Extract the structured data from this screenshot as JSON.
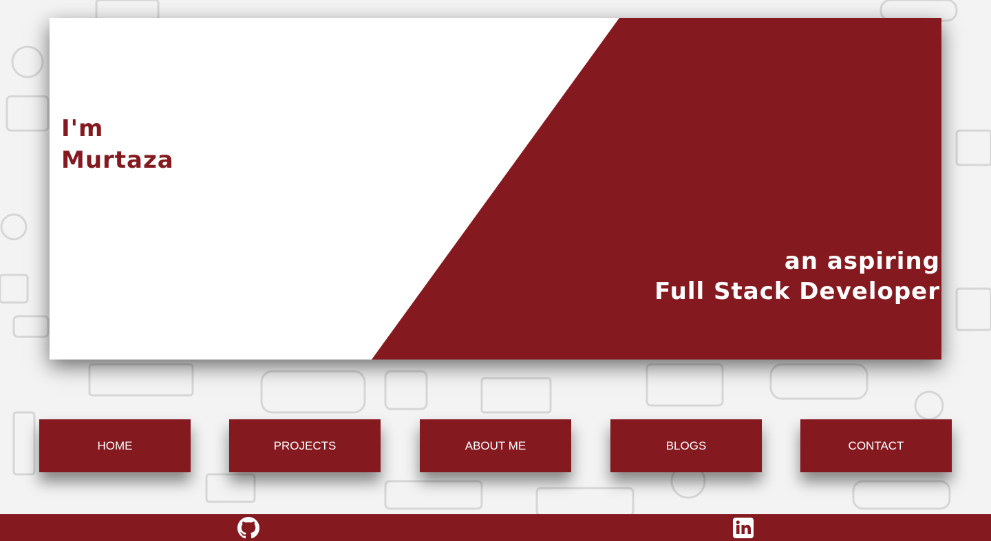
{
  "hero": {
    "intro_line1": "I'm",
    "intro_line2": "Murtaza",
    "tagline_line1": "an aspiring",
    "tagline_line2": "Full Stack Developer"
  },
  "nav": {
    "items": [
      {
        "label": "HOME"
      },
      {
        "label": "PROJECTS"
      },
      {
        "label": "ABOUT ME"
      },
      {
        "label": "BLOGS"
      },
      {
        "label": "CONTACT"
      }
    ]
  },
  "footer": {
    "icons": [
      "github-icon",
      "linkedin-icon"
    ]
  },
  "colors": {
    "accent": "#841a1f",
    "hero_bg": "#ffffff",
    "page_bg": "#f3f3f3"
  }
}
